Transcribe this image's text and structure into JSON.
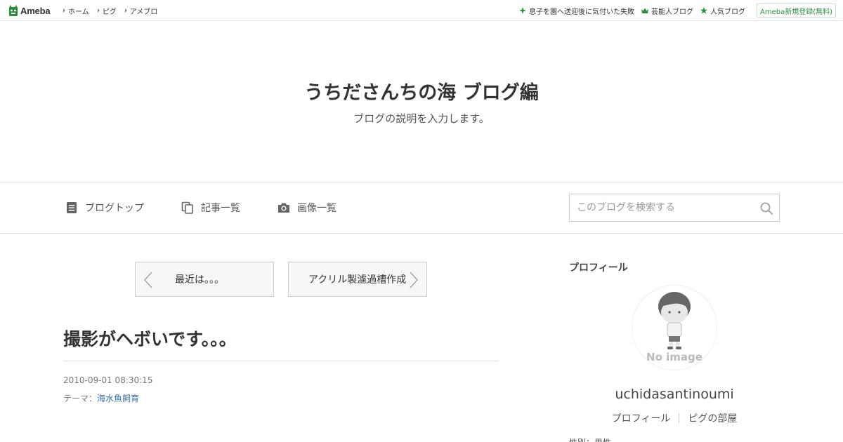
{
  "topbar": {
    "logo_text": "Ameba",
    "nav": [
      "ホーム",
      "ピグ",
      "アメブロ"
    ],
    "links": [
      {
        "label": "息子を園へ送迎後に気付いた失敗",
        "icon": "sparkle-icon"
      },
      {
        "label": "芸能人ブログ",
        "icon": "crown-icon"
      },
      {
        "label": "人気ブログ",
        "icon": "star-icon"
      }
    ],
    "register_label": "Ameba新規登録(無料)"
  },
  "header": {
    "title": "うちださんちの海 ブログ編",
    "description": "ブログの説明を入力します。"
  },
  "nav": {
    "items": [
      {
        "label": "ブログトップ",
        "icon": "document-icon"
      },
      {
        "label": "記事一覧",
        "icon": "copy-icon"
      },
      {
        "label": "画像一覧",
        "icon": "camera-icon"
      }
    ],
    "search_placeholder": "このブログを検索する"
  },
  "pager": {
    "prev_label": "最近は。。。",
    "next_label": "アクリル製濾過槽作成"
  },
  "article": {
    "title": "撮影がヘボいです。。。",
    "date": "2010-09-01 08:30:15",
    "theme_prefix": "テーマ：",
    "theme_link": "海水魚飼育"
  },
  "sidebar": {
    "heading": "プロフィール",
    "avatar_text": "No image",
    "username": "uchidasantinoumi",
    "links": [
      "プロフィール",
      "ピグの部屋"
    ],
    "cut_text": "性別：男性"
  },
  "colors": {
    "ameba_green": "#2d8c3c",
    "link_blue": "#3a6ea5"
  }
}
